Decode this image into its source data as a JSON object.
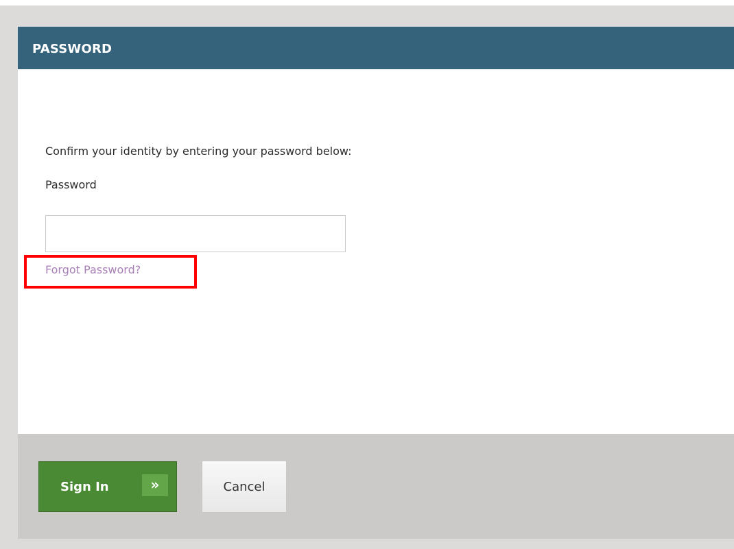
{
  "dialog": {
    "title": "PASSWORD",
    "instruction": "Confirm your identity by entering your password below:",
    "password_label": "Password",
    "password_value": "",
    "password_placeholder": "",
    "forgot_link": "Forgot Password?"
  },
  "footer": {
    "signin_label": "Sign In",
    "signin_arrow": "»",
    "cancel_label": "Cancel"
  },
  "colors": {
    "header": "#35637b",
    "primary_button": "#4a8a34",
    "link": "#a980b8",
    "highlight": "#ff0000"
  },
  "icons": {
    "signin_arrow": "double-chevron-right-icon"
  }
}
